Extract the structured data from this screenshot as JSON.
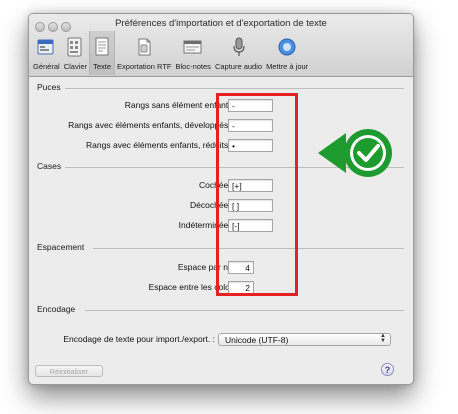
{
  "window": {
    "title": "Préférences d'importation et d'exportation de texte"
  },
  "toolbar": {
    "items": [
      {
        "label": "Général",
        "icon": "general-icon",
        "active": false
      },
      {
        "label": "Clavier",
        "icon": "keyboard-icon",
        "active": false
      },
      {
        "label": "Texte",
        "icon": "text-icon",
        "active": true
      },
      {
        "label": "Exportation RTF",
        "icon": "rtf-export-icon",
        "active": false
      },
      {
        "label": "Bloc-notes",
        "icon": "notepad-icon",
        "active": false
      },
      {
        "label": "Capture audio",
        "icon": "microphone-icon",
        "active": false
      },
      {
        "label": "Mettre à jour",
        "icon": "update-icon",
        "active": false
      }
    ]
  },
  "sections": {
    "puces": {
      "title": "Puces",
      "rows": [
        {
          "label": "Rangs sans élément enfant :",
          "value": "-"
        },
        {
          "label": "Rangs avec éléments enfants, développés :",
          "value": "-"
        },
        {
          "label": "Rangs avec éléments enfants, réduits :",
          "value": "•"
        }
      ]
    },
    "cases": {
      "title": "Cases",
      "rows": [
        {
          "label": "Cochée :",
          "value": "[+]"
        },
        {
          "label": "Décochée :",
          "value": "[ ]"
        },
        {
          "label": "Indéterminée :",
          "value": "[-]"
        }
      ]
    },
    "espacement": {
      "title": "Espacement",
      "rows": [
        {
          "label": "Espace par niveau :",
          "value": "4"
        },
        {
          "label": "Espace entre les colonnes :",
          "value": "2"
        }
      ]
    },
    "encodage": {
      "title": "Encodage",
      "label": "Encodage de texte pour import./export. :",
      "selected": "Unicode (UTF-8)"
    }
  },
  "footer": {
    "reset_label": "Réinitialiser",
    "help_label": "?"
  },
  "annotation": {
    "highlight_color": "#e52121",
    "badge_color": "#1e9b2e",
    "badge_icon": "checkmark-icon"
  }
}
